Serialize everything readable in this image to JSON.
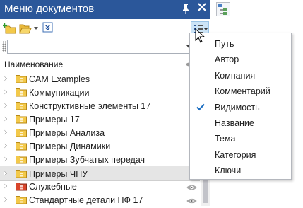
{
  "panel": {
    "title": "Меню документов"
  },
  "table": {
    "column_header": "Наименование"
  },
  "rows": [
    {
      "label": "CAM Examples",
      "folder": "yellow",
      "eye": false,
      "selected": false
    },
    {
      "label": "Коммуникации",
      "folder": "yellow",
      "eye": false,
      "selected": false
    },
    {
      "label": "Конструктивные элементы 17",
      "folder": "yellow",
      "eye": false,
      "selected": false
    },
    {
      "label": "Примеры 17",
      "folder": "yellow",
      "eye": false,
      "selected": false
    },
    {
      "label": "Примеры Анализа",
      "folder": "yellow",
      "eye": false,
      "selected": false
    },
    {
      "label": "Примеры Динамики",
      "folder": "yellow",
      "eye": false,
      "selected": false
    },
    {
      "label": "Примеры Зубчатых передач",
      "folder": "yellow",
      "eye": false,
      "selected": false
    },
    {
      "label": "Примеры ЧПУ",
      "folder": "yellow",
      "eye": false,
      "selected": true
    },
    {
      "label": "Служебные",
      "folder": "red",
      "eye": true,
      "selected": false
    },
    {
      "label": "Стандартные детали ПФ 17",
      "folder": "yellow",
      "eye": true,
      "selected": false
    }
  ],
  "menu": {
    "items": [
      {
        "label": "Путь",
        "checked": false
      },
      {
        "label": "Автор",
        "checked": false
      },
      {
        "label": "Компания",
        "checked": false
      },
      {
        "label": "Комментарий",
        "checked": false
      },
      {
        "label": "Видимость",
        "checked": true
      },
      {
        "label": "Название",
        "checked": false
      },
      {
        "label": "Тема",
        "checked": false
      },
      {
        "label": "Категория",
        "checked": false
      },
      {
        "label": "Ключи",
        "checked": false
      }
    ]
  },
  "colors": {
    "titlebar": "#2b579a",
    "check": "#1d6fc2",
    "folder_yellow": "#f3c94a",
    "folder_red": "#d9452b",
    "selected_row": "#e5e5e5"
  },
  "icons": {
    "pin": "pin-icon",
    "close": "close-icon",
    "new_folder": "new-folder-icon",
    "open_folder": "open-folder-icon",
    "collapse": "collapse-icon",
    "column_chooser": "column-chooser-icon",
    "eye": "eye-icon",
    "tree": "tree-icon"
  }
}
